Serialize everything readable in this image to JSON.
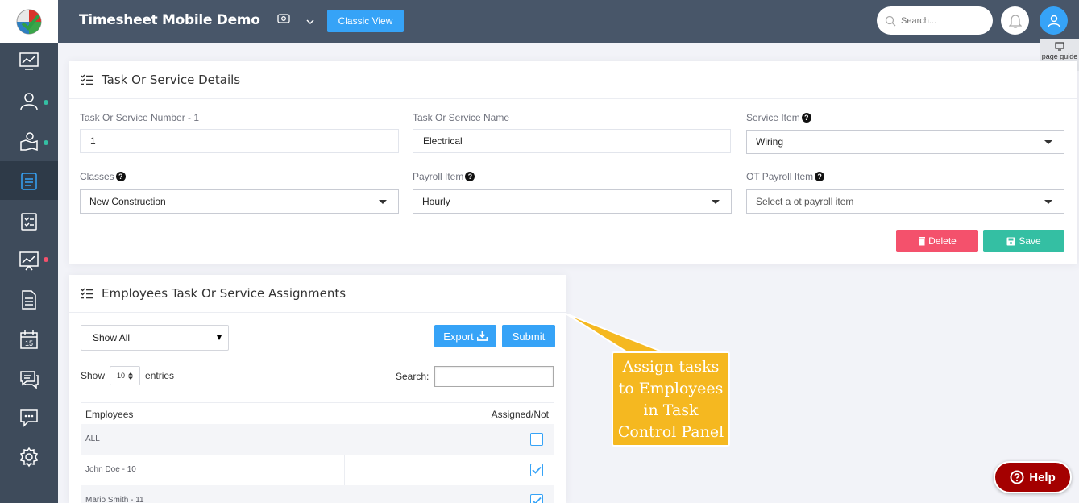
{
  "header": {
    "app_title": "Timesheet Mobile Demo",
    "classic_view_label": "Classic View",
    "search_placeholder": "Search...",
    "page_guide_label": "page guide"
  },
  "sidebar": {
    "items": [
      {
        "icon": "dashboard-icon",
        "active": false,
        "dot": null
      },
      {
        "icon": "users-icon",
        "active": false,
        "dot": "#34bfa3"
      },
      {
        "icon": "map-location-icon",
        "active": false,
        "dot": "#34bfa3"
      },
      {
        "icon": "task-board-icon",
        "active": true,
        "dot": null
      },
      {
        "icon": "checklist-icon",
        "active": false,
        "dot": null
      },
      {
        "icon": "reports-chart-icon",
        "active": false,
        "dot": "#f4516c"
      },
      {
        "icon": "document-icon",
        "active": false,
        "dot": null
      },
      {
        "icon": "calendar-icon",
        "active": false,
        "dot": null
      },
      {
        "icon": "messages-icon",
        "active": false,
        "dot": null
      },
      {
        "icon": "chat-bubble-icon",
        "active": false,
        "dot": null
      },
      {
        "icon": "settings-gear-icon",
        "active": false,
        "dot": null
      }
    ],
    "calendar_day": "15"
  },
  "task_details": {
    "title": "Task Or Service Details",
    "number_label": "Task Or Service Number - 1",
    "number_value": "1",
    "name_label": "Task Or Service Name",
    "name_value": "Electrical",
    "service_item_label": "Service Item",
    "service_item_value": "Wiring",
    "classes_label": "Classes",
    "classes_value": "New Construction",
    "payroll_item_label": "Payroll Item",
    "payroll_item_value": "Hourly",
    "ot_payroll_label": "OT Payroll Item",
    "ot_payroll_placeholder": "Select a ot payroll item",
    "delete_label": "Delete",
    "save_label": "Save"
  },
  "assignments": {
    "title": "Employees Task Or Service Assignments",
    "filter_value": "Show All",
    "export_label": "Export",
    "submit_label": "Submit",
    "show_label": "Show",
    "entries_value": "10",
    "entries_label": "entries",
    "search_label": "Search:",
    "columns": [
      "Employees",
      "Assigned/Not"
    ],
    "rows": [
      {
        "name": "ALL",
        "checked": false
      },
      {
        "name": "John Doe - 10",
        "checked": true
      },
      {
        "name": "Mario Smith - 11",
        "checked": true
      }
    ]
  },
  "callout": {
    "text": "Assign tasks to Employees in Task Control Panel"
  },
  "help_label": "Help",
  "colors": {
    "sidebar": "#3e4b5b",
    "header": "#485669",
    "primary": "#36a3f7",
    "danger": "#f4516c",
    "success": "#34bfa3",
    "callout": "#f5b820",
    "help": "#a40000"
  }
}
